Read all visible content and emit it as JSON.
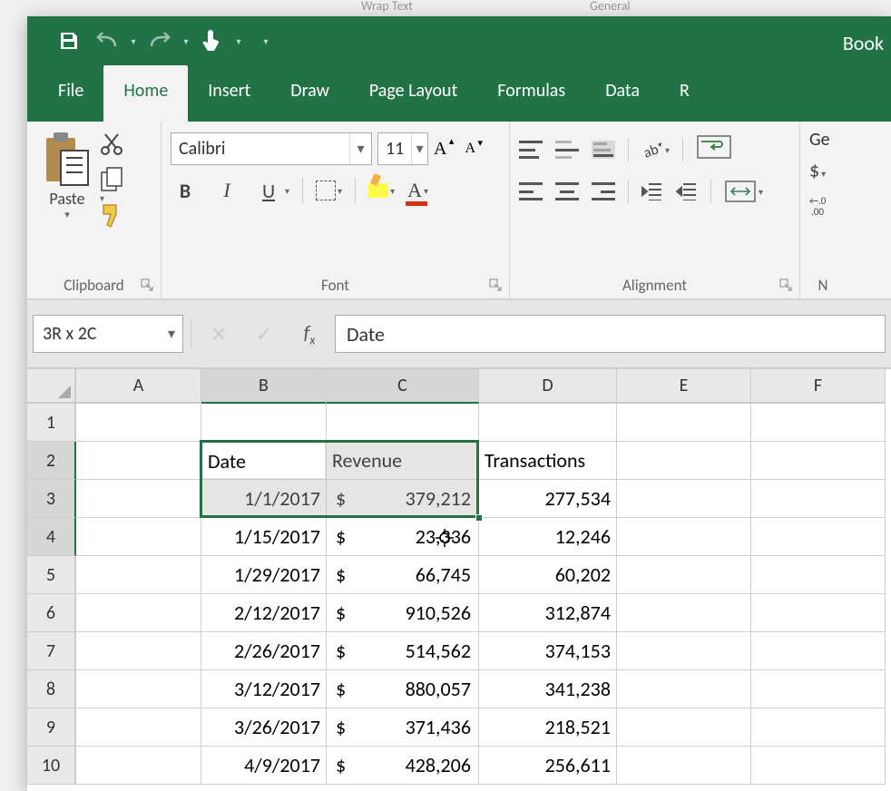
{
  "bg": {
    "wrap_text": "Wrap Text",
    "general": "General"
  },
  "title_partial": "Book",
  "tabs": [
    "File",
    "Home",
    "Insert",
    "Draw",
    "Page Layout",
    "Formulas",
    "Data",
    "R"
  ],
  "active_tab_index": 1,
  "ribbon": {
    "clipboard": {
      "label": "Clipboard",
      "paste": "Paste"
    },
    "font": {
      "label": "Font",
      "name": "Calibri",
      "size": "11"
    },
    "alignment": {
      "label": "Alignment"
    },
    "number": {
      "label": "N",
      "format_partial": "Ge",
      "dollar": "$",
      "dec": "←.0\n.00"
    }
  },
  "namebox": "3R x 2C",
  "formula": "Date",
  "columns": [
    "A",
    "B",
    "C",
    "D",
    "E",
    "F"
  ],
  "row_numbers": [
    "1",
    "2",
    "3",
    "4",
    "5",
    "6",
    "7",
    "8",
    "9",
    "10"
  ],
  "headers": {
    "b": "Date",
    "c": "Revenue",
    "d": "Transactions"
  },
  "rows": [
    {
      "date": "1/1/2017",
      "rev": "379,212",
      "tx": "277,534"
    },
    {
      "date": "1/15/2017",
      "rev": "23,336",
      "tx": "12,246"
    },
    {
      "date": "1/29/2017",
      "rev": "66,745",
      "tx": "60,202"
    },
    {
      "date": "2/12/2017",
      "rev": "910,526",
      "tx": "312,874"
    },
    {
      "date": "2/26/2017",
      "rev": "514,562",
      "tx": "374,153"
    },
    {
      "date": "3/12/2017",
      "rev": "880,057",
      "tx": "341,238"
    },
    {
      "date": "3/26/2017",
      "rev": "371,436",
      "tx": "218,521"
    },
    {
      "date": "4/9/2017",
      "rev": "428,206",
      "tx": "256,611"
    }
  ],
  "dollar_symbol": "$"
}
